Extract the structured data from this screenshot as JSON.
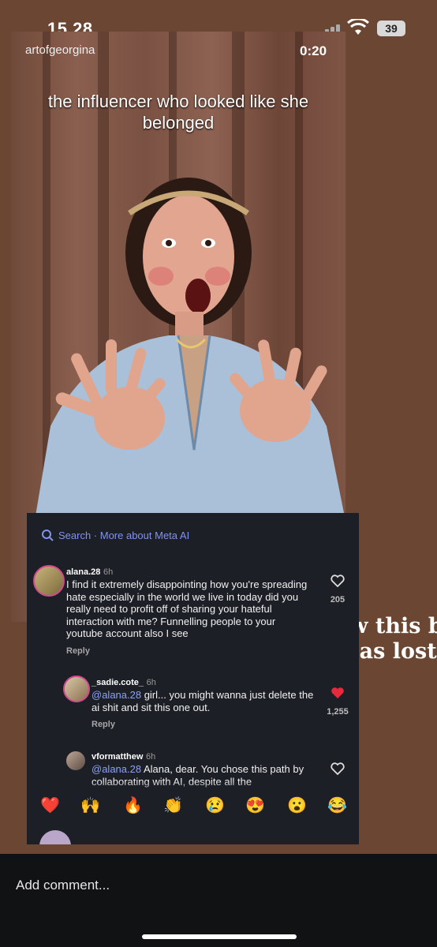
{
  "status_bar": {
    "time": "15.28",
    "battery": "39"
  },
  "video": {
    "username": "artofgeorgina",
    "timestamp": "0:20",
    "caption": "the influencer who looked like she belonged"
  },
  "overlay": {
    "line1": "wow this bi",
    "line2": "has lost i"
  },
  "comments_panel": {
    "search_label": "Search · More about Meta AI",
    "comments": [
      {
        "username": "alana.28",
        "time": "6h",
        "text": "I find it extremely disappointing how you're spreading hate especially in the world we live in today did you really need to profit off of sharing your hateful interaction with me? Funnelling people to your youtube account also I see",
        "reply_label": "Reply",
        "likes": "205"
      },
      {
        "username": "_sadie.cote_",
        "time": "6h",
        "mention": "@alana.28",
        "text": " girl... you might wanna just delete the ai shit and sit this one out.",
        "reply_label": "Reply",
        "likes": "1,255"
      },
      {
        "username": "vformatthew",
        "time": "6h",
        "mention": "@alana.28",
        "text": " Alana, dear. You chose this path by collaborating with AI, despite all the"
      }
    ],
    "emojis": [
      "❤️",
      "🙌",
      "🔥",
      "👏",
      "😢",
      "😍",
      "😮",
      "😂"
    ]
  },
  "bottom": {
    "add_comment_placeholder": "Add comment..."
  },
  "colors": {
    "background": "#6b4632",
    "panel": "#1d1f26",
    "mention": "#8aa0ff",
    "liked_heart": "#e8293b"
  },
  "icons": {
    "search": "search-icon",
    "like": "heart-outline-icon",
    "liked": "heart-filled-icon",
    "signal": "cellular-signal-icon",
    "wifi": "wifi-icon",
    "battery": "battery-icon"
  }
}
